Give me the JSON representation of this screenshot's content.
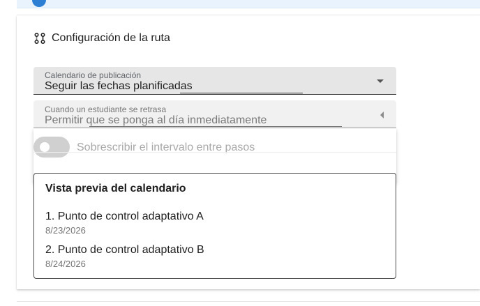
{
  "section": {
    "title": "Configuración de la ruta",
    "icon": "route-icon"
  },
  "publication_calendar": {
    "label": "Calendario de publicación",
    "value": "Seguir las fechas planificadas"
  },
  "late_student": {
    "label": "Cuando un estudiante se retrasa",
    "value": "Permitir que se ponga al día inmediatamente"
  },
  "override_toggle": {
    "label": "Sobrescribir el intervalo entre pasos",
    "checked": false
  },
  "preview": {
    "title": "Vista previa del calendario",
    "items": [
      {
        "name": "1. Punto de control adaptativo A",
        "date": "8/23/2026"
      },
      {
        "name": "2. Punto de control adaptativo B",
        "date": "8/24/2026"
      }
    ]
  },
  "colors": {
    "banner": "#e8f3fd",
    "accent": "#2d7fd3",
    "field_fill": "#e6e6e6"
  }
}
